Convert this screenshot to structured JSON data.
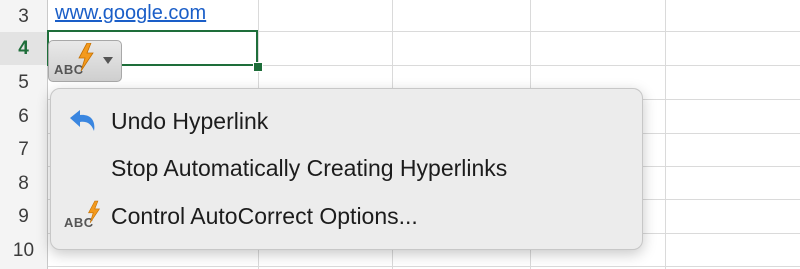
{
  "row_headers": [
    "3",
    "4",
    "5",
    "6",
    "7",
    "8",
    "9",
    "10"
  ],
  "active_row": "4",
  "cell": {
    "link_text": "www.google.com"
  },
  "autocorrect_button": {
    "abc": "ABC",
    "icon": "autocorrect-bolt-icon"
  },
  "menu": {
    "items": [
      {
        "label": "Undo Hyperlink",
        "icon": "undo-icon"
      },
      {
        "label": "Stop Automatically Creating Hyperlinks",
        "icon": ""
      },
      {
        "label": "Control AutoCorrect Options...",
        "icon": "autocorrect-bolt-icon"
      }
    ],
    "abc": "ABC"
  },
  "colors": {
    "link": "#1a5ec8",
    "selection": "#1e6e3a",
    "undo_icon": "#3a86e0",
    "bolt": "#f39a1e"
  }
}
